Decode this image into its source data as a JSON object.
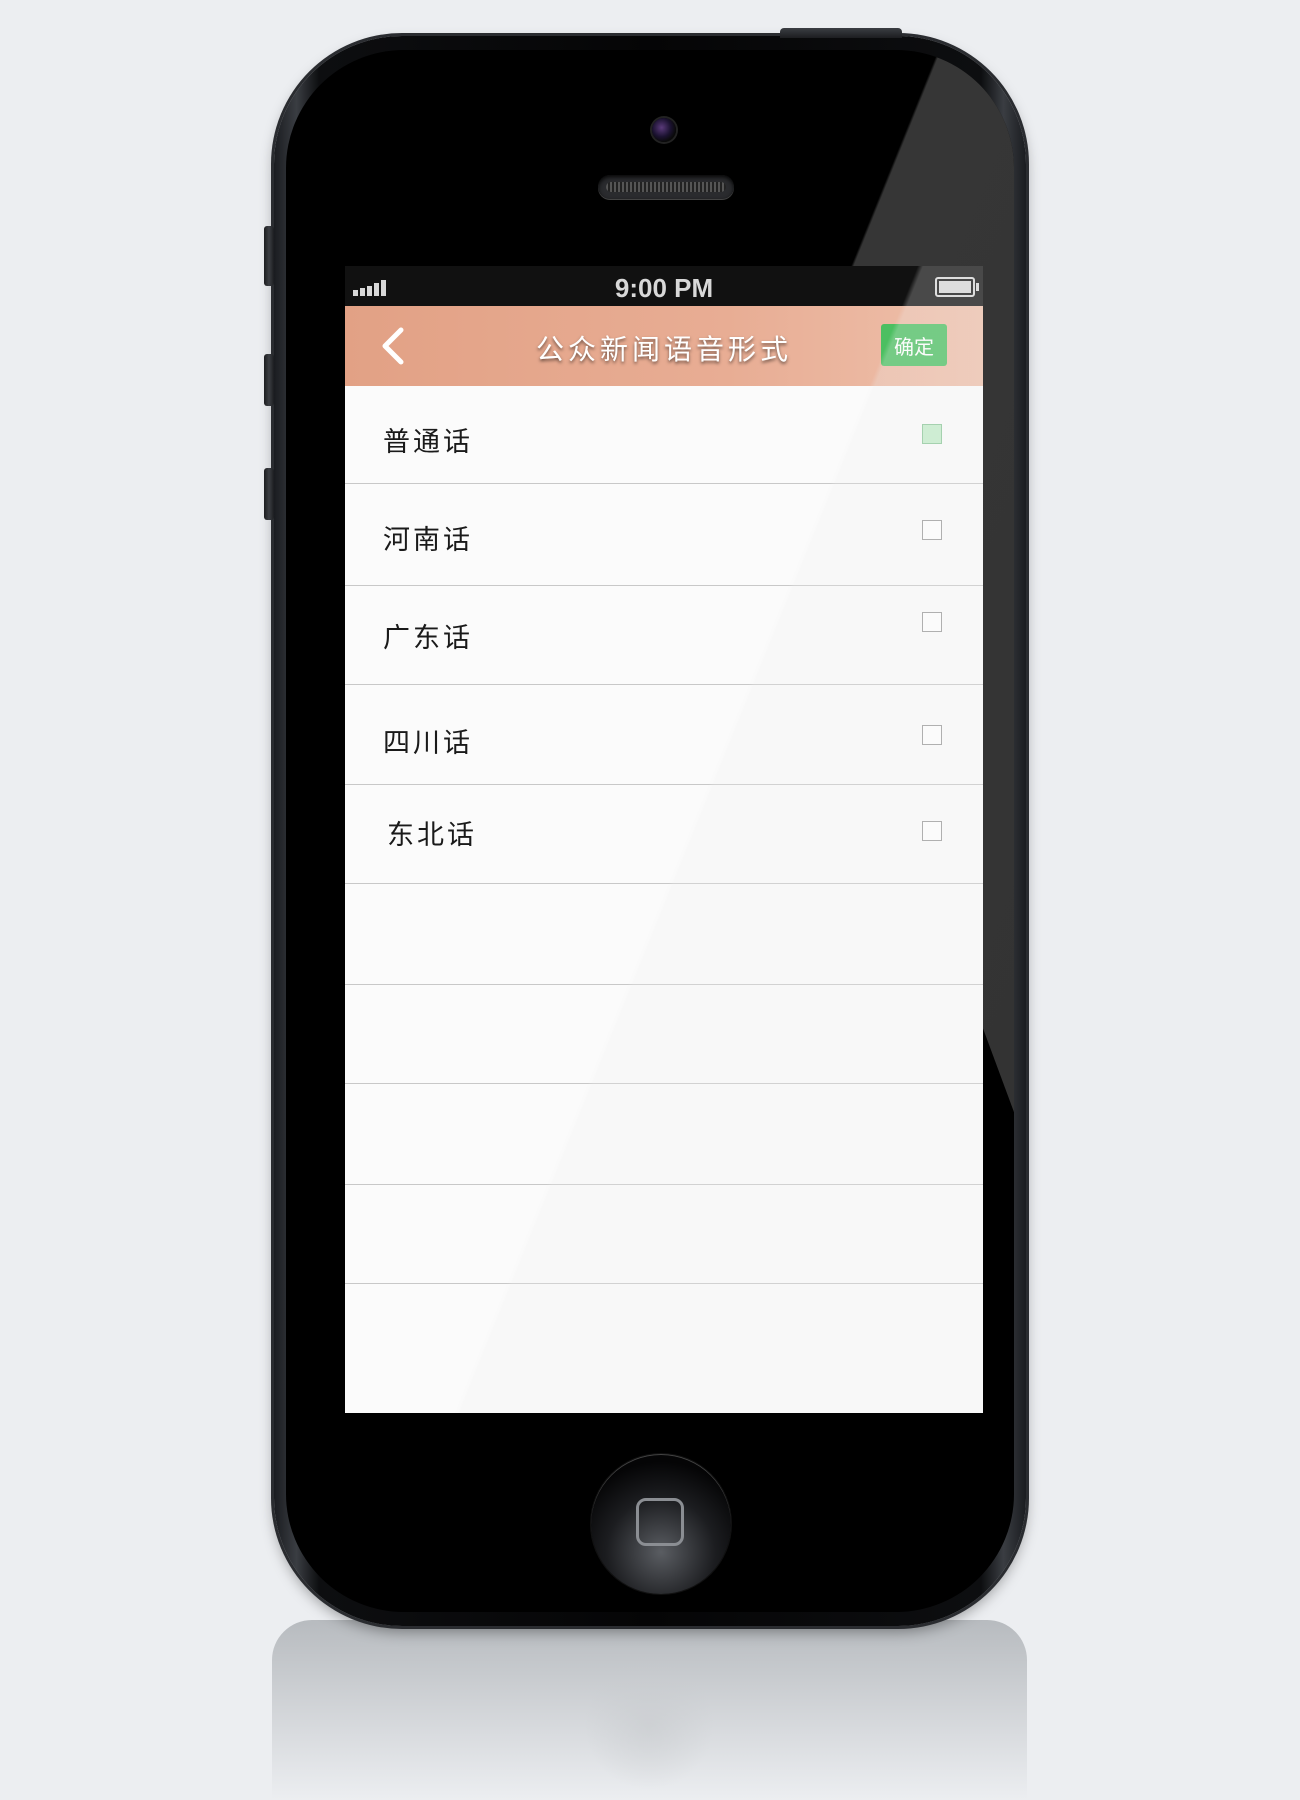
{
  "status_bar": {
    "time": "9:00 PM",
    "signal_icon": "signal-bars-icon",
    "battery_icon": "battery-icon"
  },
  "nav": {
    "back_icon": "chevron-left-icon",
    "title": "公众新闻语音形式",
    "confirm_label": "确定"
  },
  "options": [
    {
      "label": "普通话",
      "checked": true
    },
    {
      "label": "河南话",
      "checked": false
    },
    {
      "label": "广东话",
      "checked": false
    },
    {
      "label": "四川话",
      "checked": false
    },
    {
      "label": "东北话",
      "checked": false
    }
  ],
  "colors": {
    "nav_background": "#e2a185",
    "confirm_button": "#4cbf61",
    "checked_box": "#c2ecc9"
  }
}
